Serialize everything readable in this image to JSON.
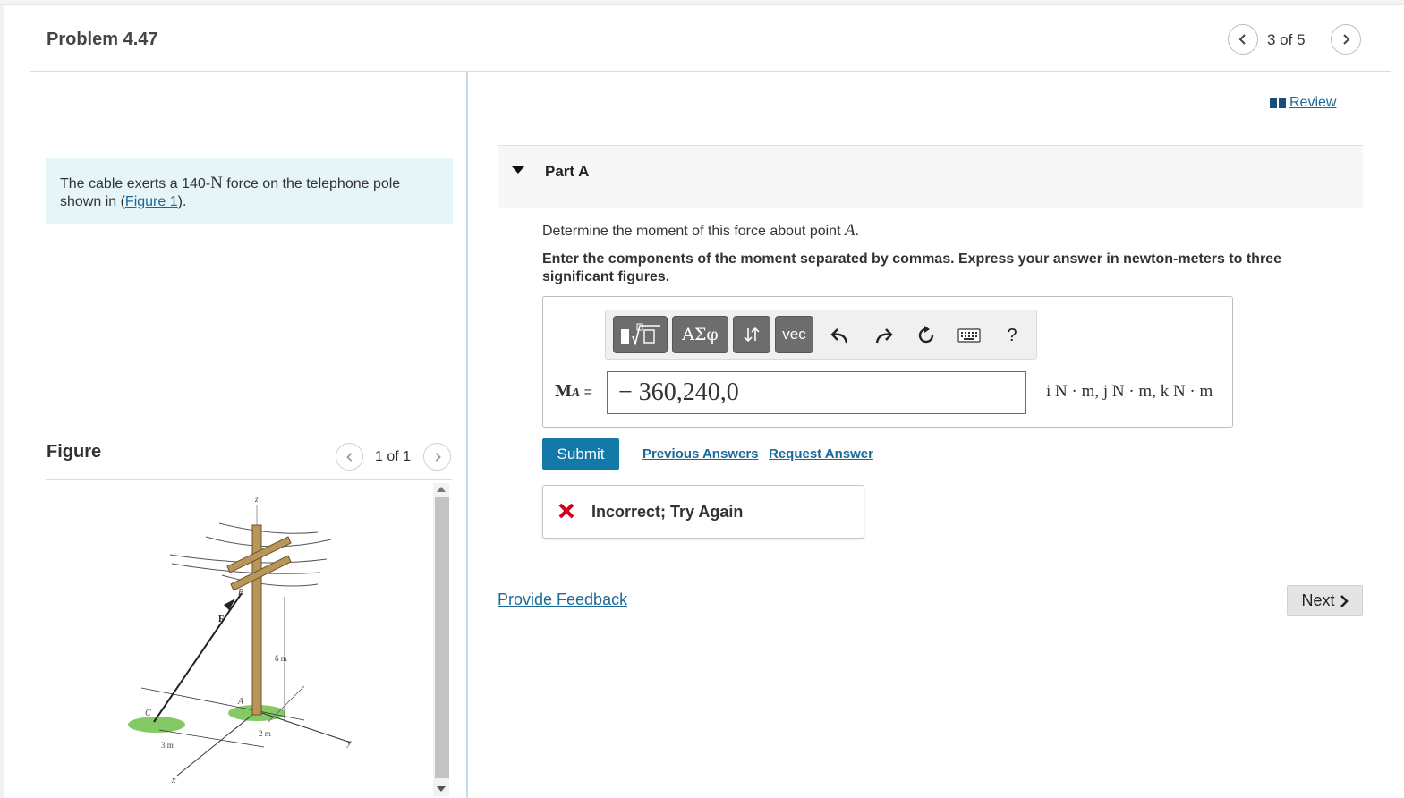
{
  "header": {
    "problem_title": "Problem 4.47",
    "pagination": "3 of 5",
    "prev_icon": "chevron-left-icon",
    "next_icon": "chevron-right-icon"
  },
  "intro": {
    "text_before": "The cable exerts a 140-",
    "unit": "N",
    "text_after": " force on the telephone pole shown in (",
    "figure_link": "Figure 1",
    "text_end": ")."
  },
  "figure_panel": {
    "label": "Figure",
    "pagination": "1 of 1",
    "labels": {
      "z": "z",
      "y": "y",
      "x": "x",
      "B": "B",
      "F": "F",
      "A": "A",
      "C": "C",
      "dim_6m": "6 m",
      "dim_2m": "2 m",
      "dim_3m": "3 m"
    }
  },
  "review": {
    "label": " Review",
    "icon": "book-icon"
  },
  "part": {
    "title": "Part A",
    "question_text": "Determine the moment of this force about point ",
    "question_point": "A",
    "question_end": ".",
    "instructions": "Enter the components of the moment separated by commas. Express your answer in newton-meters to three significant figures.",
    "toolbar": {
      "greek_label": "ΑΣφ",
      "vec_label": "vec",
      "help_label": "?",
      "icons": [
        "templates-icon",
        "greek-icon",
        "arrows-icon",
        "vec-icon",
        "undo-icon",
        "redo-icon",
        "reset-icon",
        "keyboard-icon",
        "help-icon"
      ]
    },
    "answer_label_M": "M",
    "answer_label_sub": "A",
    "answer_label_eq": " =",
    "answer_value": "− 360,240,0",
    "units": "i N · m, j N · m, k N · m",
    "submit_label": "Submit",
    "previous_answers": "Previous Answers",
    "request_answer": "Request Answer",
    "feedback": "Incorrect; Try Again",
    "colors": {
      "accent": "#1379a8",
      "link": "#1a6a98",
      "error": "#d0021b",
      "intro_bg": "#e6f5f8"
    }
  },
  "footer": {
    "provide_feedback": "Provide Feedback",
    "next_label": "Next"
  }
}
